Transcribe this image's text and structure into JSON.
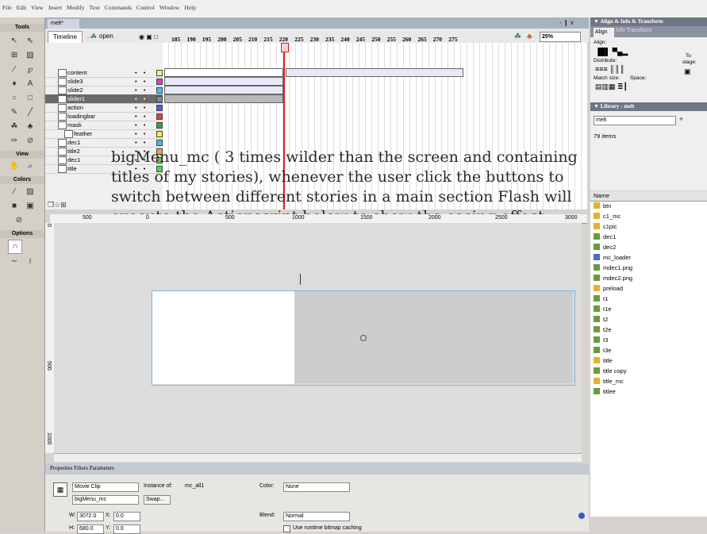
{
  "menu": [
    "File",
    "Edit",
    "View",
    "Insert",
    "Modify",
    "Text",
    "Commands",
    "Control",
    "Window",
    "Help"
  ],
  "tools": {
    "title": "Tools",
    "view": "View",
    "colors": "Colors",
    "options": "Options"
  },
  "document": {
    "tab": "melt*",
    "controls": "- ❙ x"
  },
  "timeline": {
    "tab": "Timeline",
    "scene": "open",
    "zoom": "25%"
  },
  "layers": [
    {
      "name": "content",
      "color": "#f0f080"
    },
    {
      "name": "slide3",
      "color": "#d040d0"
    },
    {
      "name": "slide2",
      "color": "#40c0ff"
    },
    {
      "name": "slider1",
      "color": "#888888",
      "selected": true
    },
    {
      "name": "action",
      "color": "#4060ff"
    },
    {
      "name": "loadingbar",
      "color": "#e04040"
    },
    {
      "name": "mask",
      "color": "#40a040"
    },
    {
      "name": "feather",
      "color": "#f0f040"
    },
    {
      "name": "dec1",
      "color": "#40c0c0"
    },
    {
      "name": "title2",
      "color": "#f0a040"
    },
    {
      "name": "dec1",
      "color": "#80c040"
    },
    {
      "name": "title",
      "color": "#40e040"
    }
  ],
  "frame_ruler": [
    "185",
    "190",
    "195",
    "200",
    "205",
    "210",
    "215",
    "220",
    "225",
    "230",
    "235",
    "240",
    "245",
    "250",
    "255",
    "260",
    "265",
    "270",
    "275"
  ],
  "annotation": "bigMenu_mc ( 3 times wilder than the screen and containing titles of my stories), whenever the user click the buttons to switch between different stories in a main section Flash will execute the Actionscript below to show the easing effect.",
  "stage_ruler": [
    "500",
    "0",
    "500",
    "1000",
    "1500",
    "2000",
    "2500",
    "3000"
  ],
  "stage_vruler": [
    "0",
    "500",
    "1000"
  ],
  "properties": {
    "tabs": "Properties  Filters  Parameters",
    "type": "Movie Clip",
    "instance_of_label": "Instance of:",
    "instance_of": "mc_all1",
    "instance_name": "bigMenu_mc",
    "swap": "Swap...",
    "color_label": "Color:",
    "color": "None",
    "w_label": "W:",
    "w": "3072.0",
    "x_label": "X:",
    "x": "0.0",
    "h_label": "H:",
    "h": "680.0",
    "y_label": "Y:",
    "y": "0.0",
    "blend_label": "Blend:",
    "blend": "Normal",
    "cache": "Use runtime bitmap caching"
  },
  "align_panel": {
    "title": "▼ Align & Info & Transform",
    "tab": "Align",
    "other_tabs": "Info  Transform",
    "align": "Align:",
    "distribute": "Distribute:",
    "match": "Match size:",
    "space": "Space:",
    "to": "To",
    "stage": "stage:"
  },
  "library": {
    "title": "▼ Library - melt",
    "file": "melt",
    "count": "79 items",
    "header": "Name",
    "items": [
      {
        "name": "btn",
        "kind": "folder"
      },
      {
        "name": "c1_mc",
        "kind": "folder"
      },
      {
        "name": "c1pic",
        "kind": "folder"
      },
      {
        "name": "dec1",
        "kind": "graphic"
      },
      {
        "name": "dec2",
        "kind": "graphic"
      },
      {
        "name": "mc_loader",
        "kind": "clip"
      },
      {
        "name": "mdec1.png",
        "kind": "graphic"
      },
      {
        "name": "mdec2.png",
        "kind": "graphic"
      },
      {
        "name": "preload",
        "kind": "folder"
      },
      {
        "name": "t1",
        "kind": "graphic"
      },
      {
        "name": "t1e",
        "kind": "graphic"
      },
      {
        "name": "t2",
        "kind": "graphic"
      },
      {
        "name": "t2e",
        "kind": "graphic"
      },
      {
        "name": "t3",
        "kind": "graphic"
      },
      {
        "name": "t3e",
        "kind": "graphic"
      },
      {
        "name": "title",
        "kind": "folder"
      },
      {
        "name": "title copy",
        "kind": "graphic"
      },
      {
        "name": "title_mc",
        "kind": "folder"
      },
      {
        "name": "titlee",
        "kind": "graphic"
      }
    ]
  },
  "colors": {
    "folder": "#e8b030",
    "graphic": "#6a9a40",
    "clip": "#4a70c8",
    "selection": "#7fb6de",
    "playhead": "#e02020"
  }
}
